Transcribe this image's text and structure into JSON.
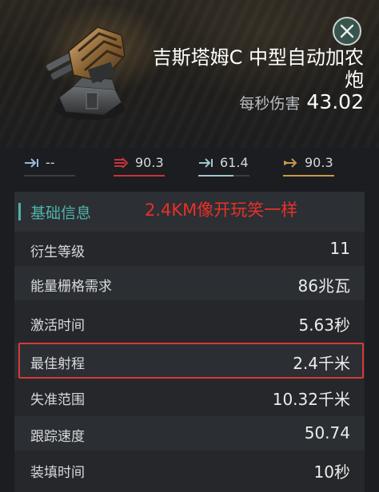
{
  "header": {
    "title": "吉斯塔姆C 中型自动加农炮",
    "dps_label": "每秒伤害",
    "dps_value": "43.02"
  },
  "damage_types": [
    {
      "icon": "em-damage-icon",
      "value": "--",
      "color": "#9ab8d8",
      "fraction": 0
    },
    {
      "icon": "thermal-damage-icon",
      "value": "90.3",
      "color": "#c8343a",
      "fraction": 1.0
    },
    {
      "icon": "kinetic-damage-icon",
      "value": "61.4",
      "color": "#9fc7cc",
      "fraction": 0.68
    },
    {
      "icon": "explosive-damage-icon",
      "value": "90.3",
      "color": "#c89a4a",
      "fraction": 1.0
    }
  ],
  "section": {
    "title": "基础信息",
    "annotation": "2.4KM像开玩笑一样"
  },
  "attributes": [
    {
      "label": "衍生等级",
      "value": "11"
    },
    {
      "label": "能量栅格需求",
      "value": "86兆瓦"
    },
    {
      "label": "激活时间",
      "value": "5.63秒"
    },
    {
      "label": "最佳射程",
      "value": "2.4千米"
    },
    {
      "label": "失准范围",
      "value": "10.32千米"
    },
    {
      "label": "跟踪速度",
      "value": "50.74"
    },
    {
      "label": "装填时间",
      "value": "10秒"
    }
  ],
  "colors": {
    "accent": "#4fb3ad",
    "annotation": "#e8302a",
    "highlight_border": "#d63a36"
  }
}
